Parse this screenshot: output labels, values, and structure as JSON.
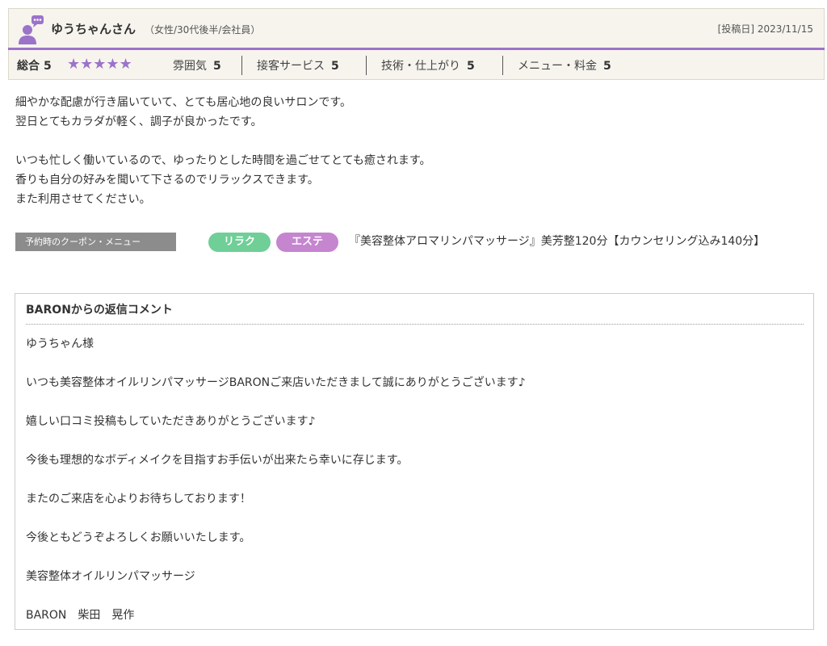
{
  "reviewer": {
    "name": "ゆうちゃんさん",
    "attributes": "（女性/30代後半/会社員）",
    "post_date": "[投稿日] 2023/11/15"
  },
  "ratings": {
    "overall_label": "総合",
    "overall_value": "5",
    "stars_filled": 5,
    "stars": "★★★★★",
    "items": [
      {
        "label": "雰囲気",
        "value": "5"
      },
      {
        "label": "接客サービス",
        "value": "5"
      },
      {
        "label": "技術・仕上がり",
        "value": "5"
      },
      {
        "label": "メニュー・料金",
        "value": "5"
      }
    ]
  },
  "review_text": {
    "lines": [
      "細やかな配慮が行き届いていて、とても居心地の良いサロンです。",
      "翌日とてもカラダが軽く、調子が良かったです。",
      "",
      "いつも忙しく働いているので、ゆったりとした時間を過ごせてとても癒されます。",
      "香りも自分の好みを聞いて下さるのでリラックスできます。",
      "また利用させてください。"
    ]
  },
  "coupon": {
    "label": "予約時のクーポン・メニュー",
    "tags": [
      "リラク",
      "エステ"
    ],
    "menu_text": "『美容整体アロマリンパマッサージ』美芳整120分【カウンセリング込み140分】"
  },
  "reply": {
    "title": "BARONからの返信コメント",
    "lines": [
      "ゆうちゃん様",
      "いつも美容整体オイルリンパマッサージBARONご来店いただきまして誠にありがとうございます♪",
      "嬉しい口コミ投稿もしていただきありがとうございます♪",
      "今後も理想的なボディメイクを目指すお手伝いが出来たら幸いに存じます。",
      "またのご来店を心よりお待ちしております！",
      "今後ともどうぞよろしくお願いいたします。",
      "美容整体オイルリンパマッサージ",
      "BARON　柴田　晃作"
    ]
  },
  "colors": {
    "accent_purple": "#9b73c9",
    "header_bg": "#f6f4ed",
    "tag_relax": "#6fcf97",
    "tag_esthe": "#c585cf",
    "coupon_label_bg": "#8c8c8c"
  },
  "icons": {
    "avatar": "user-with-speech-bubble-icon"
  }
}
